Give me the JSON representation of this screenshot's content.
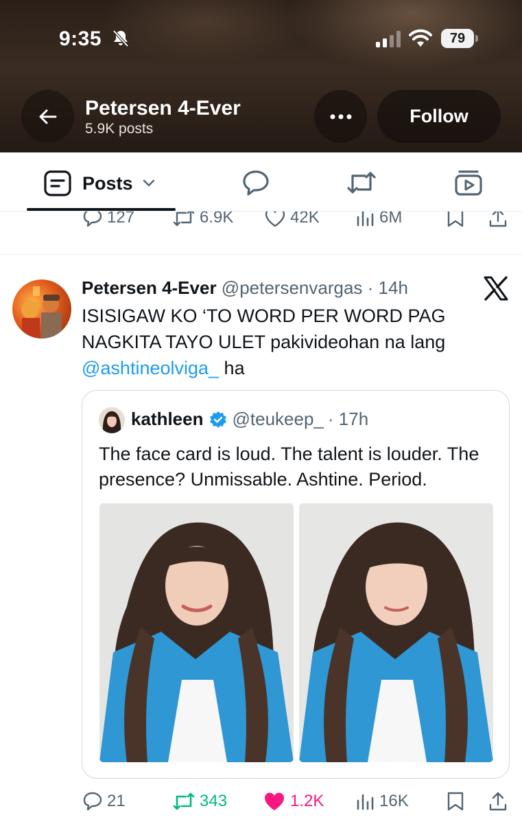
{
  "status_bar": {
    "time": "9:35",
    "battery": "79"
  },
  "header": {
    "title": "Petersen 4-Ever",
    "post_count": "5.9K posts",
    "follow_label": "Follow"
  },
  "tabs": {
    "posts_label": "Posts"
  },
  "previous_tweet": {
    "replies": "127",
    "reposts": "6.9K",
    "likes": "42K",
    "views": "6M"
  },
  "tweet": {
    "author_name": "Petersen 4-Ever",
    "author_handle": "@petersenvargas",
    "time": "· 14h",
    "text_main": "ISISIGAW KO ‘TO WORD PER WORD PAG NAGKITA TAYO ULET pakivideohan na lang",
    "mention": "@ashtineolviga_",
    "text_tail": " ha",
    "quote": {
      "name": "kathleen",
      "handle": "@teukeep_",
      "time": "· 17h",
      "text": "The face card is loud. The talent is louder. The presence? Unmissable. Ashtine. Period."
    },
    "stats": {
      "replies": "21",
      "reposts": "343",
      "likes": "1.2K",
      "views": "16K"
    }
  },
  "colors": {
    "accent": "#1d9bf0",
    "repost_green": "#00ba7c",
    "like_pink": "#f91880",
    "secondary_text": "#536471"
  },
  "icons": [
    "bell-off-icon",
    "signal-icon",
    "wifi-icon",
    "battery-icon",
    "back-arrow-icon",
    "more-icon",
    "posts-icon",
    "chevron-down-icon",
    "replies-tab-icon",
    "reposts-tab-icon",
    "media-tab-icon",
    "reply-icon",
    "repost-icon",
    "like-icon",
    "views-icon",
    "bookmark-icon",
    "share-icon",
    "x-logo-icon",
    "verified-badge-icon"
  ]
}
